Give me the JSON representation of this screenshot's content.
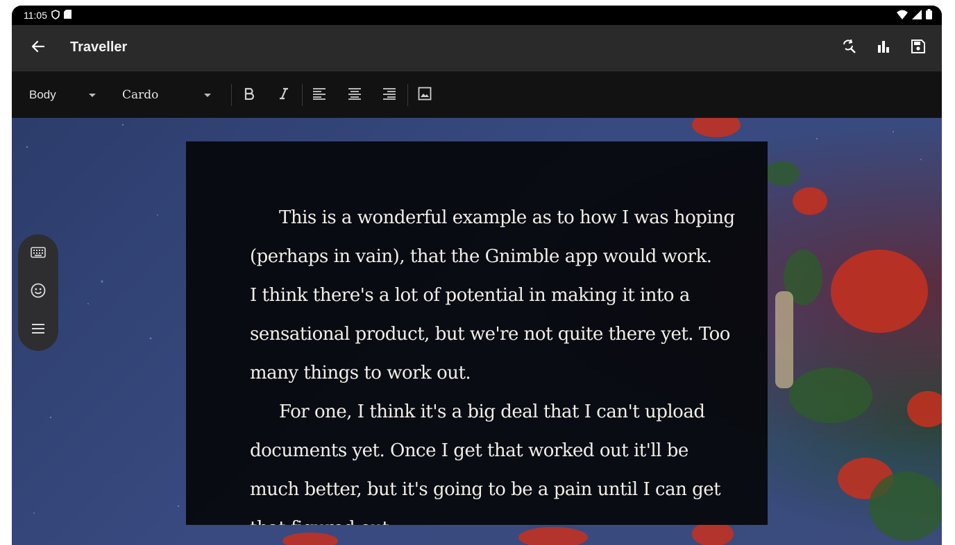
{
  "status_bar": {
    "time": "11:05",
    "icons": [
      "shield-icon",
      "sd-card-icon",
      "wifi-icon",
      "signal-icon",
      "battery-icon"
    ]
  },
  "app_bar": {
    "title": "Traveller",
    "actions": [
      "find-replace-icon",
      "stats-icon",
      "save-icon"
    ]
  },
  "toolbar": {
    "style_select": "Body",
    "font_select": "Cardo",
    "buttons": [
      "bold-icon",
      "italic-icon",
      "align-left-icon",
      "align-center-icon",
      "align-right-icon",
      "image-icon"
    ]
  },
  "editor": {
    "paragraphs": [
      "This is a wonderful example as to how I was hoping (perhaps in vain), that the Gnimble app would work.",
      "I think there's a lot of potential in making it into a sensational product, but we're not quite there yet. Too many things to work out.",
      "For one, I think it's a big deal that I can't upload documents yet. Once I get that worked out it'll be much better, but it's going to be a pain until I can get that figured out."
    ]
  },
  "side_menu": {
    "buttons": [
      "keyboard-icon",
      "emoji-icon",
      "menu-icon"
    ]
  },
  "colors": {
    "app_bar": "#2a2a2a",
    "toolbar": "#121212",
    "editor_bg": "#05060a",
    "editor_text": "#f2efe8"
  }
}
